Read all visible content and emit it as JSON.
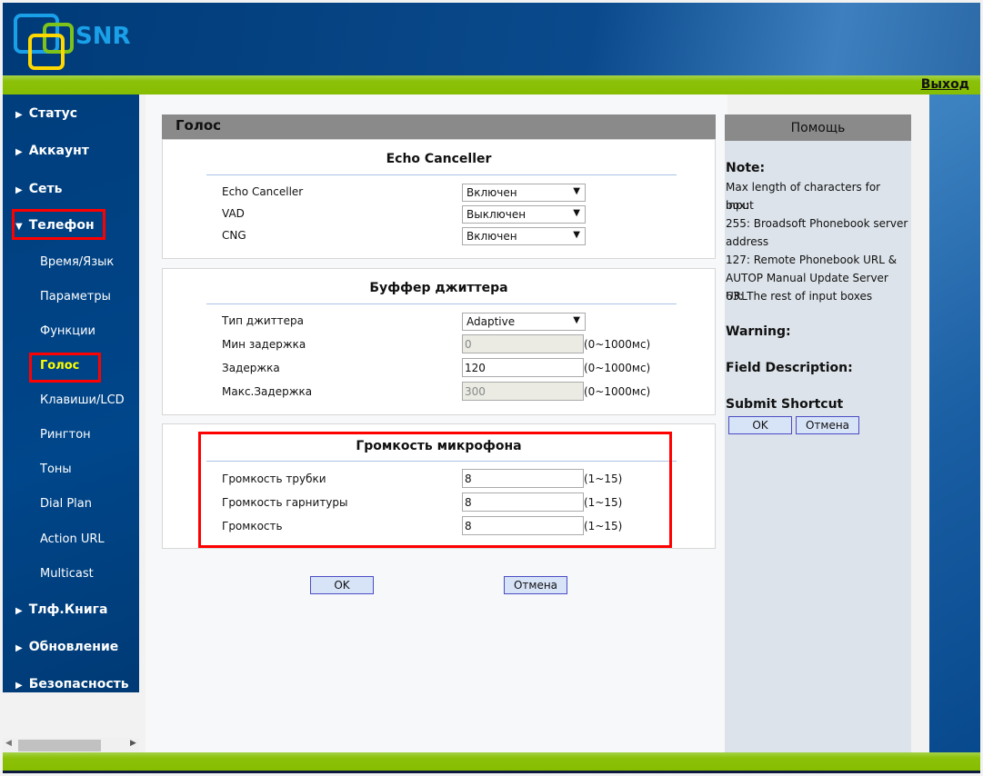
{
  "header": {
    "logo_text": "SNR",
    "logout": "Выход"
  },
  "sidebar": {
    "items": [
      {
        "label": "Статус"
      },
      {
        "label": "Аккаунт"
      },
      {
        "label": "Сеть"
      },
      {
        "label": "Телефон"
      },
      {
        "label": "Тлф.Книга"
      },
      {
        "label": "Обновление"
      },
      {
        "label": "Безопасность"
      }
    ],
    "phone_sub": [
      {
        "label": "Время/Язык"
      },
      {
        "label": "Параметры"
      },
      {
        "label": "Функции"
      },
      {
        "label": "Голос"
      },
      {
        "label": "Клавиши/LCD"
      },
      {
        "label": "Рингтон"
      },
      {
        "label": "Тоны"
      },
      {
        "label": "Dial Plan"
      },
      {
        "label": "Action URL"
      },
      {
        "label": "Multicast"
      }
    ],
    "active_color": "#ffff00"
  },
  "page": {
    "title": "Голос"
  },
  "echo": {
    "title": "Echo Canceller",
    "rows": [
      {
        "label": "Echo Canceller",
        "value": "Включен"
      },
      {
        "label": "VAD",
        "value": "Выключен"
      },
      {
        "label": "CNG",
        "value": "Включен"
      }
    ]
  },
  "jitter": {
    "title": "Буффер джиттера",
    "rows": [
      {
        "label": "Тип джиттера",
        "value": "Adaptive"
      },
      {
        "label": "Мин задержка",
        "value": "0",
        "range": "(0~1000мс)"
      },
      {
        "label": "Задержка",
        "value": "120",
        "range": "(0~1000мс)"
      },
      {
        "label": "Макс.Задержка",
        "value": "300",
        "range": "(0~1000мс)"
      }
    ]
  },
  "mic": {
    "title": "Громкость микрофона",
    "rows": [
      {
        "label": "Громкость трубки",
        "value": "8",
        "range": "(1~15)"
      },
      {
        "label": "Громкость гарнитуры",
        "value": "8",
        "range": "(1~15)"
      },
      {
        "label": "Громкость",
        "value": "8",
        "range": "(1~15)"
      }
    ]
  },
  "buttons": {
    "ok": "OK",
    "cancel": "Отмена"
  },
  "help": {
    "title": "Помощь",
    "note_h": "Note:",
    "note_lines": [
      "Max length of characters for input",
      "box:",
      "255: Broadsoft Phonebook server",
      "address",
      "127: Remote Phonebook URL &",
      "AUTOP Manual Update Server URL",
      "63: The rest of input boxes"
    ],
    "warning_h": "Warning:",
    "field_h": "Field Description:",
    "submit_h": "Submit Shortcut",
    "ok": "OK",
    "cancel": "Отмена"
  }
}
